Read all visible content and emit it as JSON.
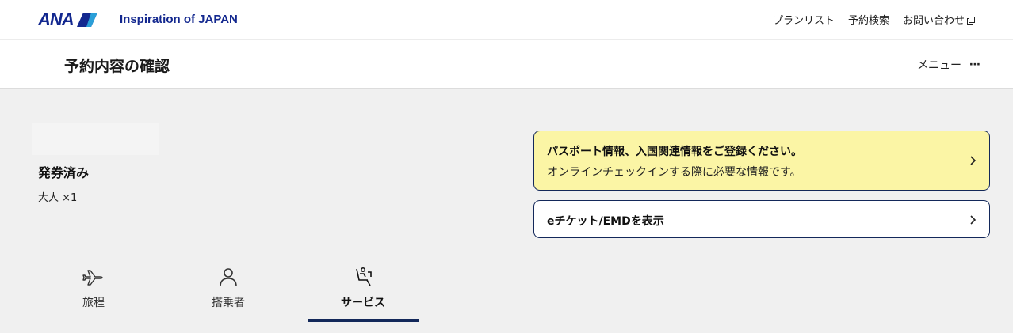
{
  "header": {
    "logo_text": "ANA",
    "tagline": "Inspiration of JAPAN",
    "nav": [
      "プランリスト",
      "予約検索",
      "お問い合わせ"
    ]
  },
  "page": {
    "title": "予約内容の確認",
    "menu_label": "メニュー"
  },
  "booking": {
    "status": "発券済み",
    "passengers": "大人 ×1"
  },
  "cards": {
    "passport": {
      "title": "パスポート情報、入国関連情報をご登録ください。",
      "subtitle": "オンラインチェックインする際に必要な情報です。"
    },
    "eticket": {
      "title": "eチケット/EMDを表示"
    }
  },
  "tabs": [
    {
      "label": "旅程",
      "icon": "airplane-icon"
    },
    {
      "label": "搭乗者",
      "icon": "person-icon"
    },
    {
      "label": "サービス",
      "icon": "seat-icon",
      "active": true
    }
  ],
  "colors": {
    "brand_navy": "#13288f",
    "accent_dark": "#13285a",
    "notice_yellow": "#fbf5a5",
    "background": "#f0f0f0"
  }
}
